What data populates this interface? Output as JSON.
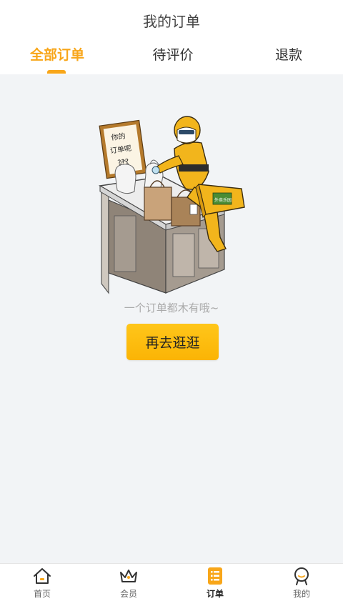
{
  "header": {
    "title": "我的订单"
  },
  "tabs": [
    {
      "label": "全部订单",
      "active": true
    },
    {
      "label": "待评价",
      "active": false
    },
    {
      "label": "退款",
      "active": false
    }
  ],
  "illustration": {
    "sign_text": [
      "你的",
      "订单呢",
      "???"
    ],
    "box_label": "外卖乐园"
  },
  "empty_state": {
    "message": "一个订单都木有哦~",
    "button_label": "再去逛逛"
  },
  "bottom_nav": [
    {
      "label": "首页",
      "icon": "home-icon",
      "active": false
    },
    {
      "label": "会员",
      "icon": "crown-icon",
      "active": false
    },
    {
      "label": "订单",
      "icon": "order-list-icon",
      "active": true
    },
    {
      "label": "我的",
      "icon": "profile-icon",
      "active": false
    }
  ],
  "colors": {
    "accent": "#f8a619",
    "button": "#fbb405",
    "background": "#f2f4f6"
  }
}
